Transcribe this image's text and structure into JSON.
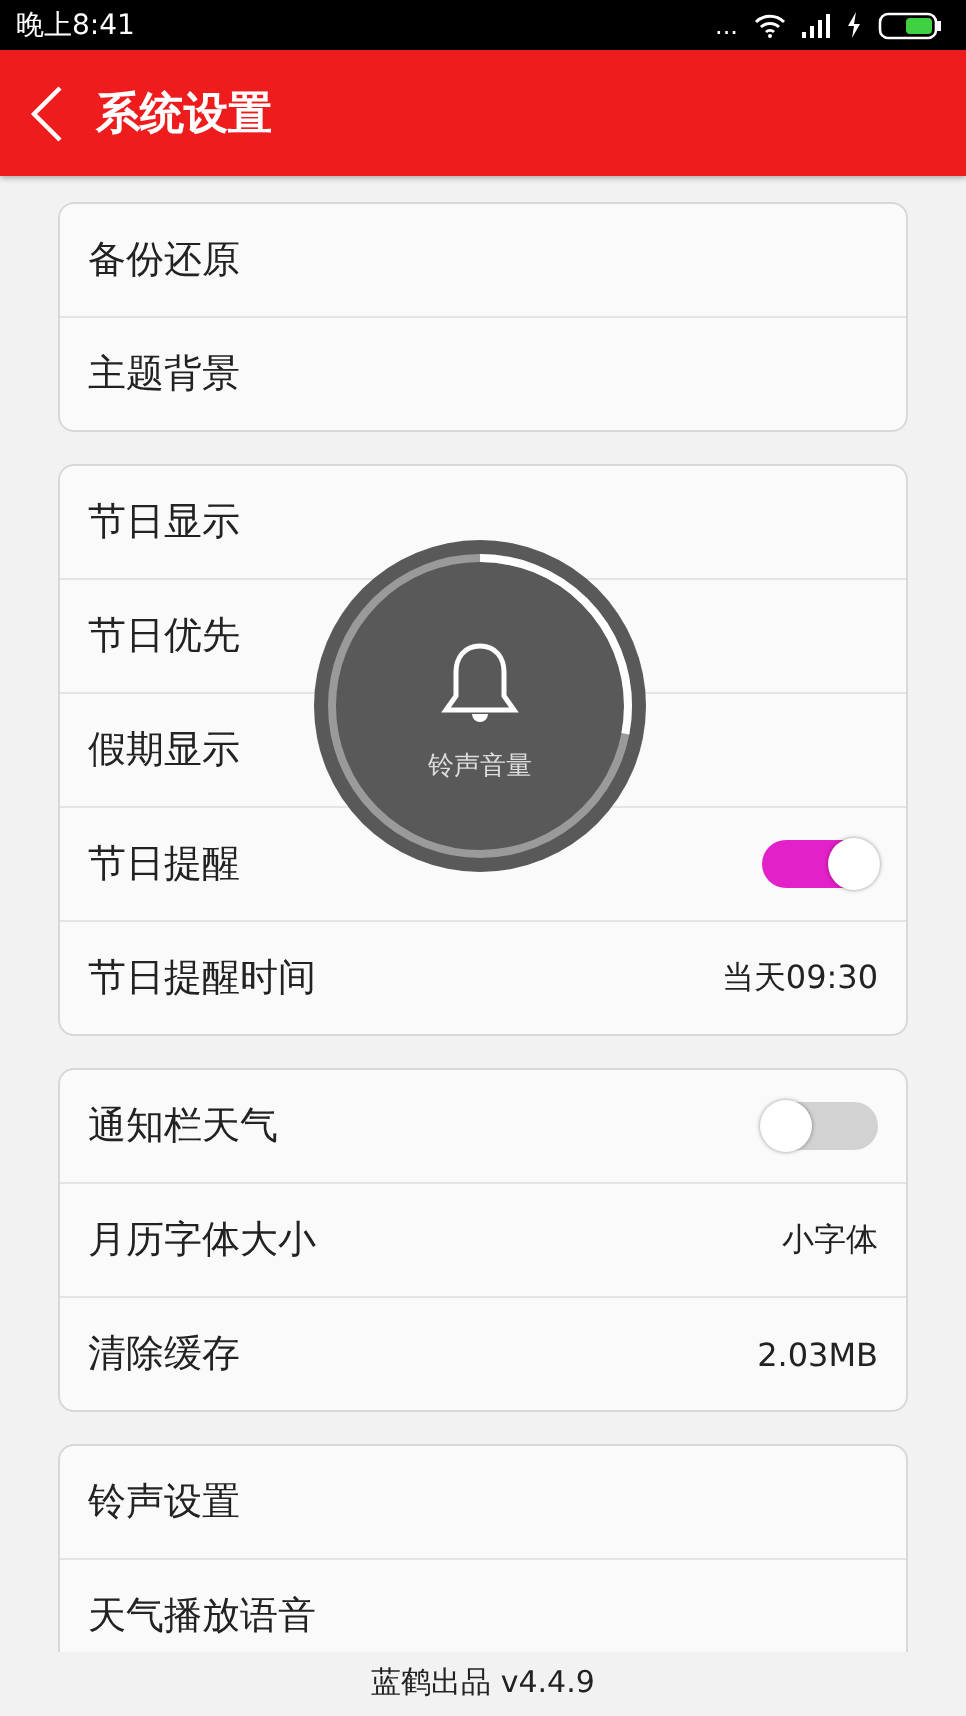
{
  "status_bar": {
    "time": "晚上8:41",
    "more": "..."
  },
  "header": {
    "title": "系统设置"
  },
  "groups": [
    {
      "rows": [
        {
          "kind": "plain",
          "label": "备份还原"
        },
        {
          "kind": "plain",
          "label": "主题背景"
        }
      ]
    },
    {
      "rows": [
        {
          "kind": "plain",
          "label": "节日显示"
        },
        {
          "kind": "plain",
          "label": "节日优先"
        },
        {
          "kind": "plain",
          "label": "假期显示"
        },
        {
          "kind": "toggle",
          "label": "节日提醒",
          "on": true
        },
        {
          "kind": "value",
          "label": "节日提醒时间",
          "value": "当天09:30"
        }
      ]
    },
    {
      "rows": [
        {
          "kind": "toggle",
          "label": "通知栏天气",
          "on": false
        },
        {
          "kind": "value",
          "label": "月历字体大小",
          "value": "小字体"
        },
        {
          "kind": "value",
          "label": "清除缓存",
          "value": "2.03MB"
        }
      ]
    },
    {
      "rows": [
        {
          "kind": "plain",
          "label": "铃声设置"
        },
        {
          "kind": "plain",
          "label": "天气播放语音"
        }
      ]
    }
  ],
  "footer": "蓝鹤出品 v4.4.9",
  "volume_overlay": {
    "label": "铃声音量",
    "level": 0.28
  }
}
